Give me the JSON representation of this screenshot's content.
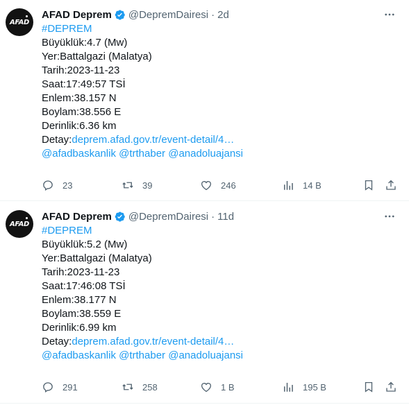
{
  "tweets": [
    {
      "avatar_text": "AFAD",
      "name": "AFAD Deprem",
      "handle": "@DepremDairesi",
      "separator": "·",
      "time": "2d",
      "hashtag": "#DEPREM",
      "lines": [
        "Büyüklük:4.7 (Mw)",
        "Yer:Battalgazi (Malatya)",
        "Tarih:2023-11-23",
        "Saat:17:49:57 TSİ",
        "Enlem:38.157 N",
        "Boylam:38.556 E",
        "Derinlik:6.36 km"
      ],
      "detail_label": "Detay:",
      "detail_link": "deprem.afad.gov.tr/event-detail/4…",
      "mentions": "@afadbaskanlik @trthaber @anadoluajansi",
      "replies": "23",
      "retweets": "39",
      "likes": "246",
      "views": "14 B"
    },
    {
      "avatar_text": "AFAD",
      "name": "AFAD Deprem",
      "handle": "@DepremDairesi",
      "separator": "·",
      "time": "11d",
      "hashtag": "#DEPREM",
      "lines": [
        "Büyüklük:5.2 (Mw)",
        "Yer:Battalgazi (Malatya)",
        "Tarih:2023-11-23",
        "Saat:17:46:08 TSİ",
        "Enlem:38.177 N",
        "Boylam:38.559 E",
        "Derinlik:6.99 km"
      ],
      "detail_label": "Detay:",
      "detail_link": "deprem.afad.gov.tr/event-detail/4…",
      "mentions": "@afadbaskanlik @trthaber @anadoluajansi",
      "replies": "291",
      "retweets": "258",
      "likes": "1 B",
      "views": "195 B"
    }
  ],
  "colors": {
    "link": "#1d9bf0",
    "verified": "#1d9bf0",
    "muted": "#536471",
    "text": "#0f1419"
  },
  "icons": [
    "verified-badge-icon",
    "more-icon",
    "reply-icon",
    "retweet-icon",
    "like-icon",
    "views-icon",
    "bookmark-icon",
    "share-icon"
  ]
}
